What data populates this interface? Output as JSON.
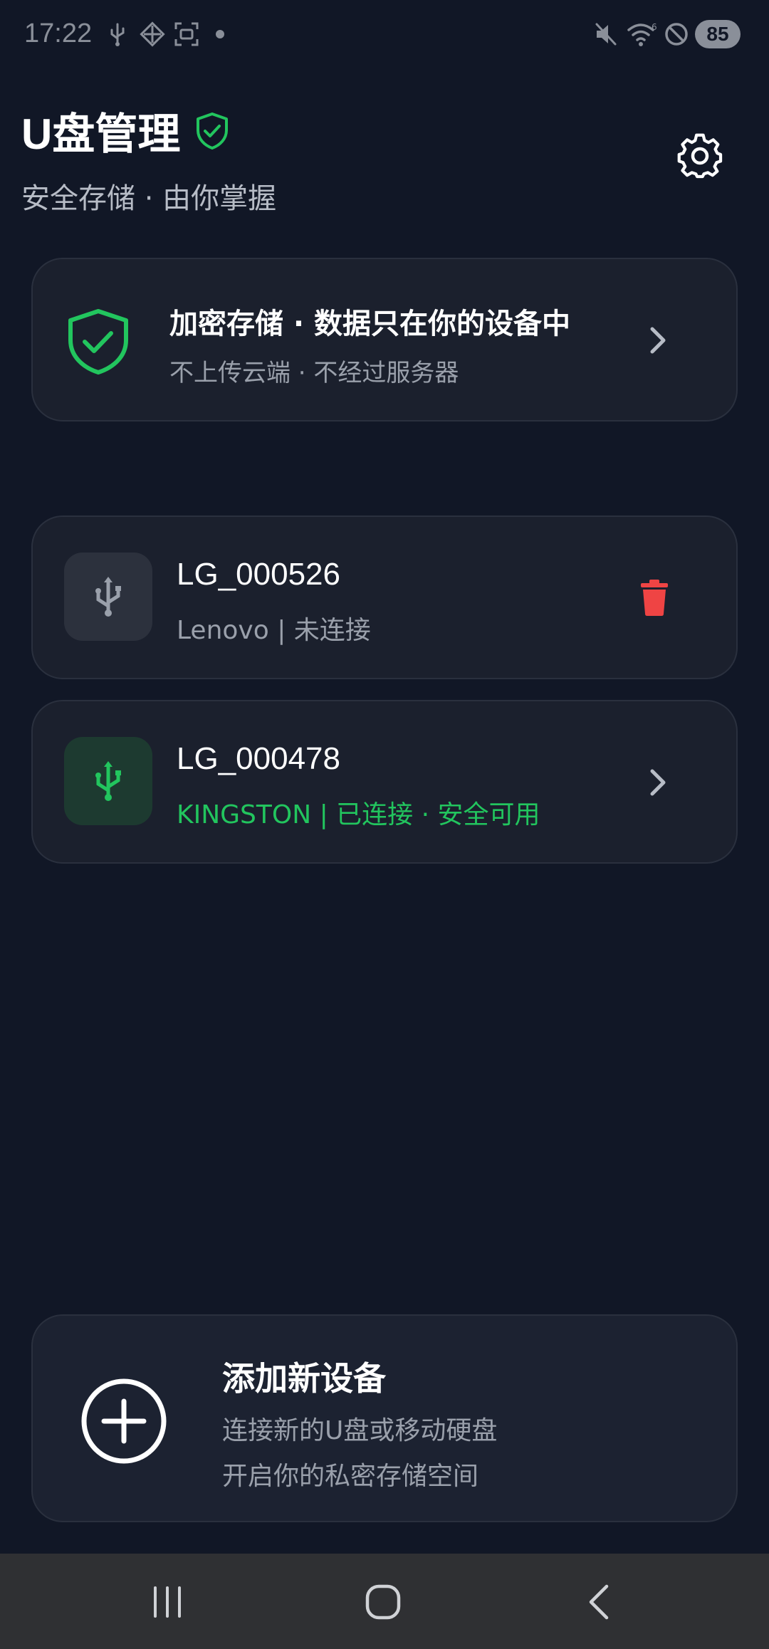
{
  "status_bar": {
    "time": "17:22",
    "left_icons": [
      "usb-icon",
      "diamond-grid-icon",
      "screenshot-icon",
      "dot-icon"
    ],
    "right_icons": [
      "mute-icon",
      "wifi-icon",
      "do-not-disturb-icon"
    ],
    "battery": "85"
  },
  "header": {
    "title": "U盘管理",
    "subtitle": "安全存储 · 由你掌握",
    "title_icon": "shield-check-icon",
    "settings_icon": "gear-icon"
  },
  "security_banner": {
    "title": "加密存储 · 数据只在你的设备中",
    "description": "不上传云端 · 不经过服务器",
    "icon": "shield-check-icon"
  },
  "devices": [
    {
      "name": "LG_000526",
      "status": "Lenovo | 未连接",
      "connected": false,
      "action_icon": "trash-icon",
      "status_color": "#9aa0ab"
    },
    {
      "name": "LG_000478",
      "status": "KINGSTON | 已连接 · 安全可用",
      "connected": true,
      "action_icon": "chevron-right-icon",
      "status_color": "#22c55e"
    }
  ],
  "add_device": {
    "title": "添加新设备",
    "line1": "连接新的U盘或移动硬盘",
    "line2": "开启你的私密存储空间",
    "icon": "plus-circle-icon"
  },
  "colors": {
    "background": "#111726",
    "card": "#1b202d",
    "accent_green": "#22c55e",
    "danger_red": "#ef4444",
    "muted_text": "#9aa0ab"
  },
  "nav_bar": {
    "buttons": [
      "recents-icon",
      "home-icon",
      "back-icon"
    ]
  }
}
